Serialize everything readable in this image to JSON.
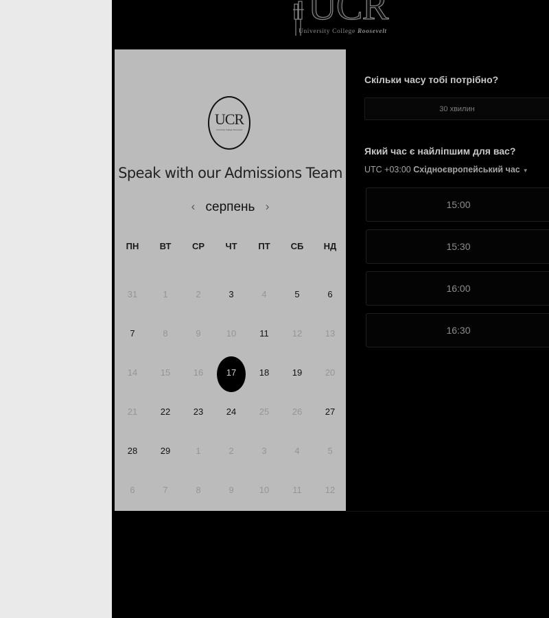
{
  "logo": {
    "letters": "UCR",
    "subtitle_plain": "University College ",
    "subtitle_italic": "Roosevelt"
  },
  "calendar": {
    "title": "Speak with our Admissions Team",
    "month": "серпень",
    "prev_arrow": "‹",
    "next_arrow": "›",
    "weekdays": [
      "ПН",
      "ВТ",
      "СР",
      "ЧТ",
      "ПТ",
      "СБ",
      "НД"
    ],
    "days": [
      {
        "label": "31",
        "state": "outside"
      },
      {
        "label": "1",
        "state": "unavailable"
      },
      {
        "label": "2",
        "state": "unavailable"
      },
      {
        "label": "3",
        "state": "available"
      },
      {
        "label": "4",
        "state": "unavailable"
      },
      {
        "label": "5",
        "state": "available"
      },
      {
        "label": "6",
        "state": "available"
      },
      {
        "label": "7",
        "state": "available"
      },
      {
        "label": "8",
        "state": "unavailable"
      },
      {
        "label": "9",
        "state": "unavailable"
      },
      {
        "label": "10",
        "state": "unavailable"
      },
      {
        "label": "11",
        "state": "available"
      },
      {
        "label": "12",
        "state": "unavailable"
      },
      {
        "label": "13",
        "state": "unavailable"
      },
      {
        "label": "14",
        "state": "unavailable"
      },
      {
        "label": "15",
        "state": "unavailable"
      },
      {
        "label": "16",
        "state": "unavailable"
      },
      {
        "label": "17",
        "state": "selected"
      },
      {
        "label": "18",
        "state": "available"
      },
      {
        "label": "19",
        "state": "available"
      },
      {
        "label": "20",
        "state": "unavailable"
      },
      {
        "label": "21",
        "state": "unavailable"
      },
      {
        "label": "22",
        "state": "available"
      },
      {
        "label": "23",
        "state": "available"
      },
      {
        "label": "24",
        "state": "available"
      },
      {
        "label": "25",
        "state": "unavailable"
      },
      {
        "label": "26",
        "state": "unavailable"
      },
      {
        "label": "27",
        "state": "available"
      },
      {
        "label": "28",
        "state": "available"
      },
      {
        "label": "29",
        "state": "available"
      },
      {
        "label": "1",
        "state": "outside"
      },
      {
        "label": "2",
        "state": "outside"
      },
      {
        "label": "3",
        "state": "outside"
      },
      {
        "label": "4",
        "state": "outside"
      },
      {
        "label": "5",
        "state": "outside"
      },
      {
        "label": "6",
        "state": "outside"
      },
      {
        "label": "7",
        "state": "outside"
      },
      {
        "label": "8",
        "state": "outside"
      },
      {
        "label": "9",
        "state": "outside"
      },
      {
        "label": "10",
        "state": "outside"
      },
      {
        "label": "11",
        "state": "outside"
      },
      {
        "label": "12",
        "state": "outside"
      }
    ]
  },
  "booking": {
    "duration_heading": "Скільки часу тобі потрібно?",
    "duration_value": "30 хвилин",
    "time_heading": "Який час є найліпшим для вас?",
    "tz_offset": "UTC +03:00 ",
    "tz_name": "Східноєвропейський час",
    "tz_caret": "▼",
    "slots": [
      "15:00",
      "15:30",
      "16:00",
      "16:30"
    ]
  },
  "colors": {
    "page_left": "#eaeaea",
    "background": "#000000",
    "calendar_card": "#bbbbbb",
    "selected_day": "#000000"
  }
}
